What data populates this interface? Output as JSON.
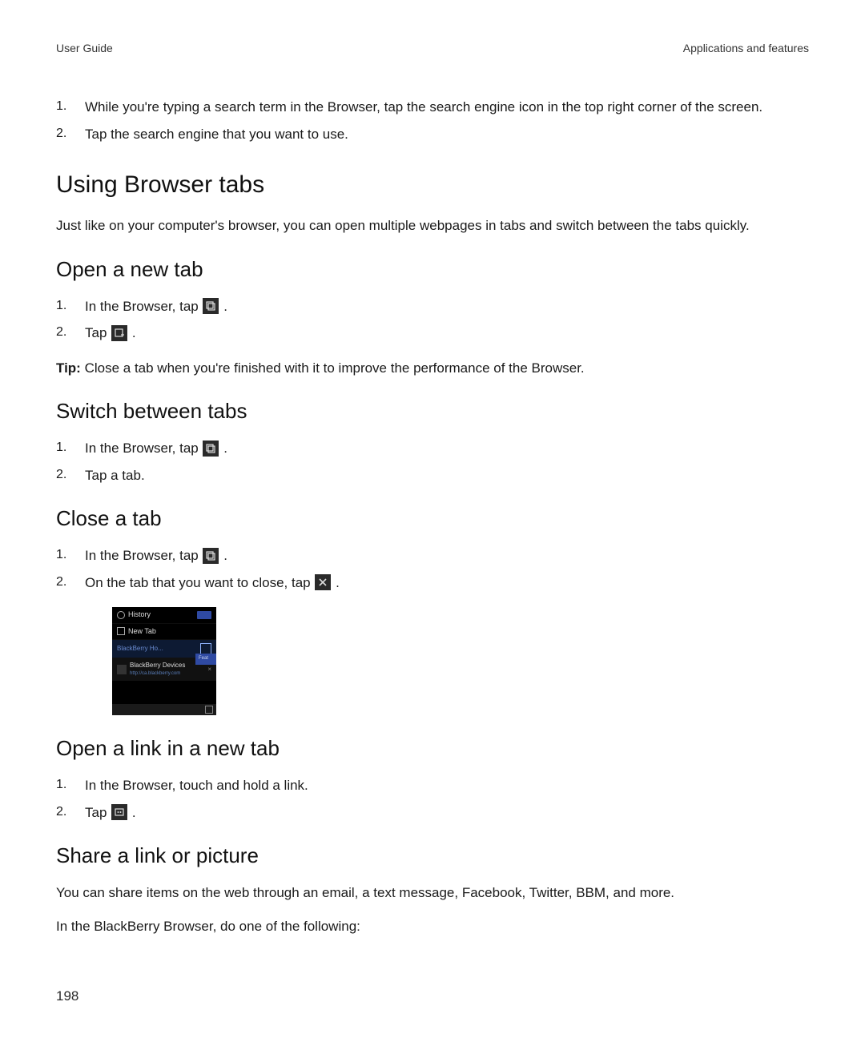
{
  "header": {
    "left": "User Guide",
    "right": "Applications and features"
  },
  "intro_steps": [
    "While you're typing a search term in the Browser, tap the search engine icon in the top right corner of the screen.",
    "Tap the search engine that you want to use."
  ],
  "using_tabs": {
    "title": "Using Browser tabs",
    "desc": "Just like on your computer's browser, you can open multiple webpages in tabs and switch between the tabs quickly."
  },
  "open_new_tab": {
    "title": "Open a new tab",
    "step1_pre": "In the Browser, tap ",
    "step1_post": ".",
    "step2_pre": "Tap ",
    "step2_post": ".",
    "tip_label": "Tip: ",
    "tip_text": "Close a tab when you're finished with it to improve the performance of the Browser."
  },
  "switch_tabs": {
    "title": "Switch between tabs",
    "step1_pre": "In the Browser, tap ",
    "step1_post": ".",
    "step2": "Tap a tab."
  },
  "close_tab": {
    "title": "Close a tab",
    "step1_pre": "In the Browser, tap ",
    "step1_post": ".",
    "step2_pre": "On the tab that you want to close, tap ",
    "step2_post": "."
  },
  "screenshot": {
    "history": "History",
    "newtab": "New Tab",
    "devices": "BlackBerry Devices",
    "devurl": "http://ca.blackberry.com",
    "feat": "Feat"
  },
  "open_link": {
    "title": "Open a link in a new tab",
    "step1": "In the Browser, touch and hold a link.",
    "step2_pre": "Tap ",
    "step2_post": "."
  },
  "share": {
    "title": "Share a link or picture",
    "p1": "You can share items on the web through an email, a text message, Facebook, Twitter, BBM, and more.",
    "p2": "In the BlackBerry Browser, do one of the following:"
  },
  "page_number": "198"
}
